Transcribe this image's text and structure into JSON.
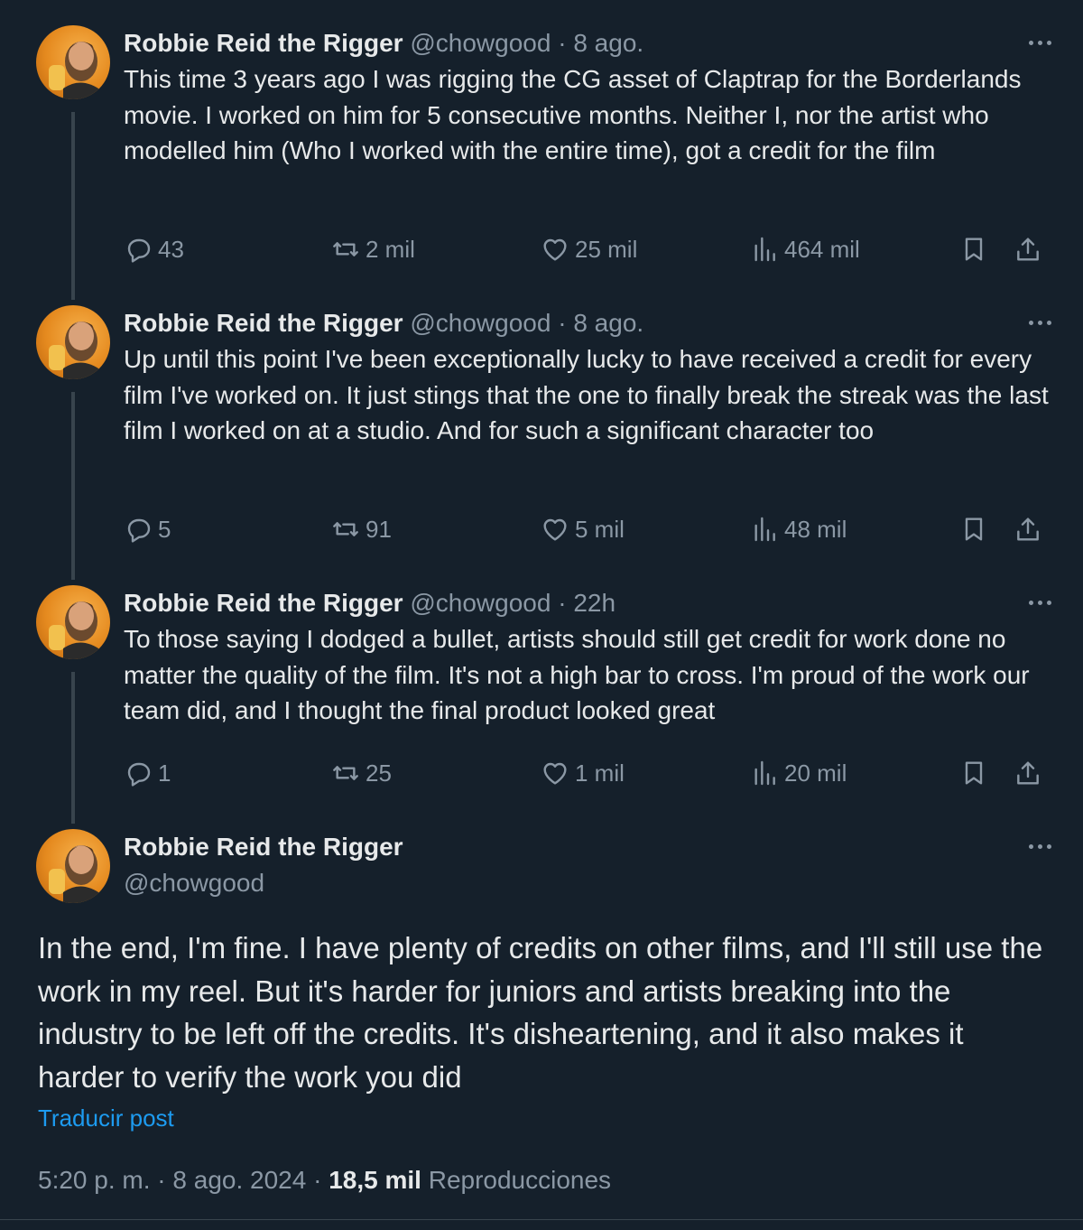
{
  "posts": [
    {
      "name": "Robbie Reid the Rigger",
      "handle": "@chowgood",
      "sep": "·",
      "time": "8 ago.",
      "text": "This time 3 years ago I was rigging the CG asset of Claptrap for the Borderlands movie. I worked on him for 5 consecutive months. Neither I, nor the artist who modelled him (Who I worked with the entire time), got a credit for the film",
      "replies": "43",
      "reposts": "2 mil",
      "likes": "25 mil",
      "views": "464 mil"
    },
    {
      "name": "Robbie Reid the Rigger",
      "handle": "@chowgood",
      "sep": "·",
      "time": "8 ago.",
      "text": "Up until this point I've been exceptionally lucky to have received a credit for every film I've worked on. It just stings that the one to finally break the streak was the last film I worked on at a studio. And for such a significant character too",
      "replies": "5",
      "reposts": "91",
      "likes": "5 mil",
      "views": "48 mil"
    },
    {
      "name": "Robbie Reid the Rigger",
      "handle": "@chowgood",
      "sep": "·",
      "time": "22h",
      "text": "To those saying I dodged a bullet, artists should still get credit for work done no matter the quality of the film. It's not a high bar to cross. I'm proud of the work our team did, and I thought the final product looked great",
      "replies": "1",
      "reposts": "25",
      "likes": "1 mil",
      "views": "20 mil"
    }
  ],
  "main_post": {
    "name": "Robbie Reid the Rigger",
    "handle": "@chowgood",
    "text": "In the end, I'm fine. I have plenty of credits on other films, and I'll still use the work in my reel. But it's harder for juniors and artists breaking into the industry to be left off the credits. It's disheartening, and it also makes it harder to verify the work you did",
    "translate": "Traducir post",
    "timestamp": "5:20 p. m. · 8 ago. 2024 · ",
    "views_count": "18,5 mil",
    "views_label": " Reproducciones"
  },
  "colors": {
    "background": "#15202b",
    "text": "#e7e9ea",
    "muted": "#8b98a5",
    "link": "#1d9bf0",
    "thread_line": "#38444d"
  },
  "icons": [
    "reply-icon",
    "repost-icon",
    "like-icon",
    "views-icon",
    "bookmark-icon",
    "share-icon",
    "more-icon"
  ]
}
